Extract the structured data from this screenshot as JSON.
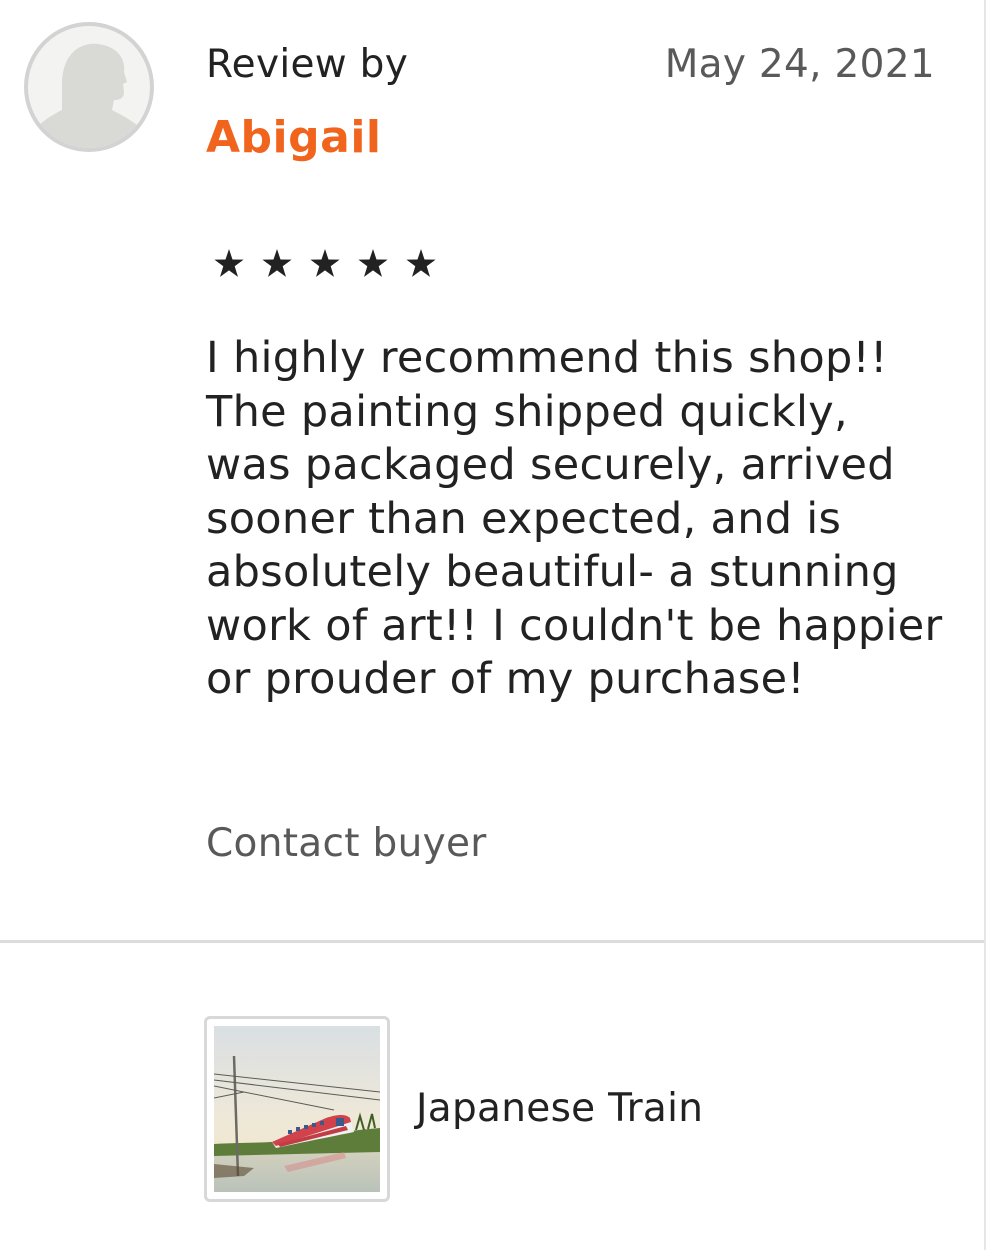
{
  "review": {
    "header_label": "Review by",
    "reviewer_name": "Abigail",
    "date": "May 24, 2021",
    "rating": 5,
    "rating_max": 5,
    "text": "I highly recommend this shop!! The painting shipped quickly, was packaged securely, arrived sooner than expected, and is absolutely beautiful- a stunning work of art!! I couldn't be happier or prouder of my purchase!",
    "contact_label": "Contact buyer"
  },
  "listing": {
    "title": "Japanese Train",
    "thumbnail_icon": "painting-thumbnail"
  },
  "colors": {
    "accent": "#f1641e",
    "text": "#222222",
    "muted": "#595959",
    "divider": "#dcdcdc"
  }
}
